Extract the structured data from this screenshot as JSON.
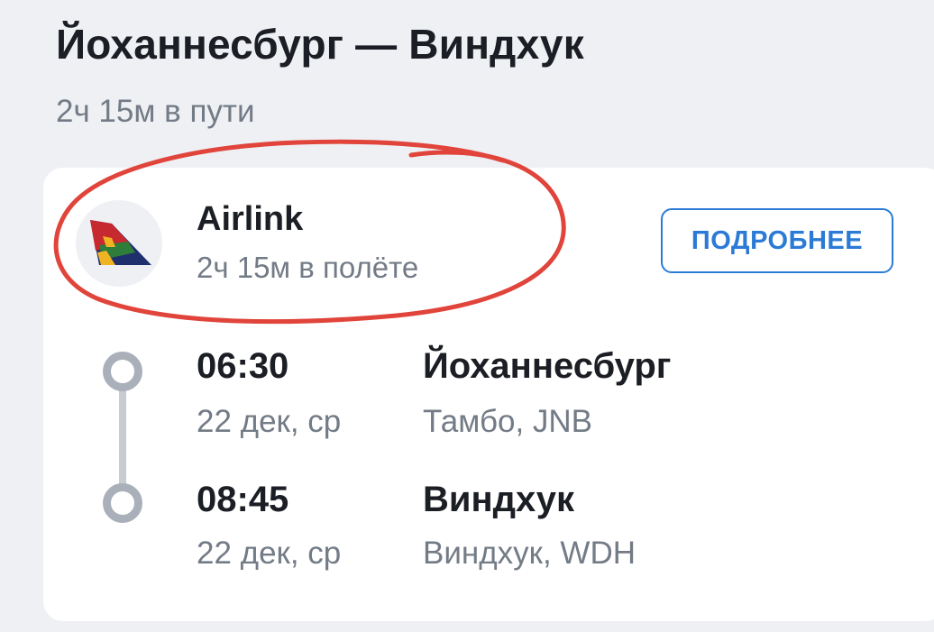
{
  "route": {
    "title": "Йоханнесбург — Виндхук",
    "total_duration": "2ч 15м в пути"
  },
  "flight": {
    "airline": "Airlink",
    "airline_logo_icon": "airlink-tail-logo-icon",
    "flight_duration": "2ч 15м в полёте",
    "details_button": "ПОДРОБНЕЕ"
  },
  "departure": {
    "time": "06:30",
    "date": "22 дек, ср",
    "city": "Йоханнесбург",
    "airport": "Тамбо, JNB"
  },
  "arrival": {
    "time": "08:45",
    "date": "22 дек, ср",
    "city": "Виндхук",
    "airport": "Виндхук, WDH"
  },
  "colors": {
    "background": "#eef0f4",
    "card": "#ffffff",
    "accent_blue": "#2b7bd6",
    "annotation_red": "#e0443a",
    "timeline_gray": "#a9b0ba"
  }
}
